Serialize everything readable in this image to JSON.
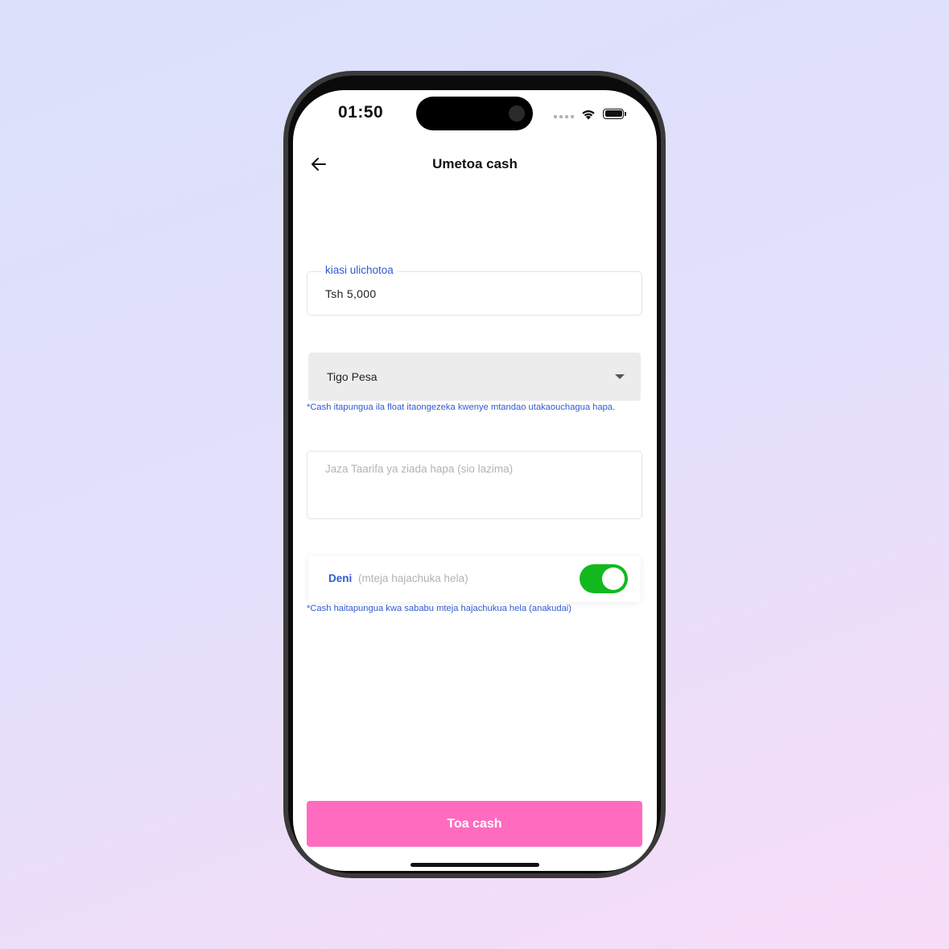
{
  "status_bar": {
    "time": "01:50"
  },
  "header": {
    "title": "Umetoa cash",
    "back_icon": "arrow-left-icon"
  },
  "amount_field": {
    "label": "kiasi ulichotoa",
    "value": "Tsh 5,000"
  },
  "network_select": {
    "selected": "Tigo Pesa",
    "hint": "*Cash itapungua ila float itaongezeka kwenye mtandao utakaouchagua hapa."
  },
  "notes_field": {
    "placeholder": "Jaza Taarifa ya ziada hapa (sio lazima)"
  },
  "debt_toggle": {
    "label": "Deni",
    "sublabel": "(mteja hajachuka hela)",
    "on": true,
    "hint": "*Cash haitapungua kwa sababu mteja hajachukua hela (anakudai)"
  },
  "submit": {
    "label": "Toa cash"
  },
  "colors": {
    "accent_blue": "#2f5bd1",
    "button_pink": "#ff6cbf",
    "toggle_green": "#12b91d"
  }
}
